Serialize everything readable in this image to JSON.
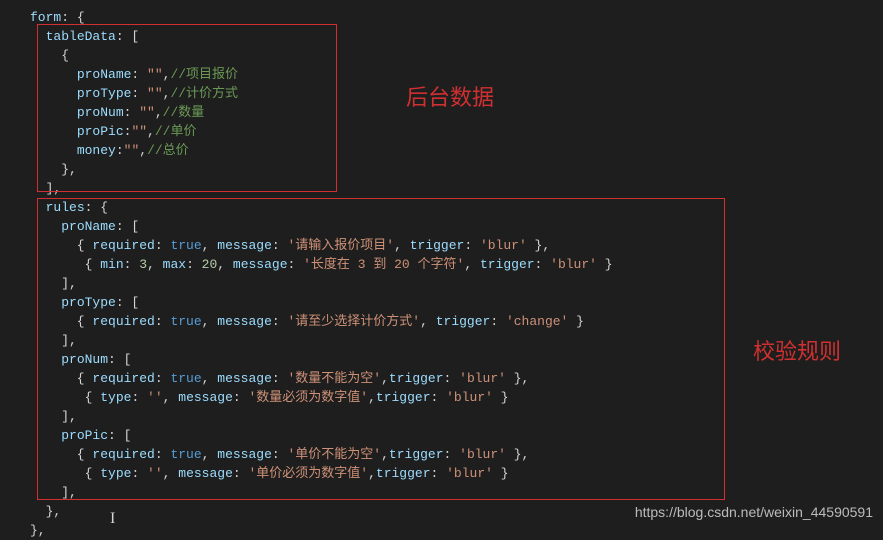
{
  "annotations": {
    "label1": "后台数据",
    "label2": "校验规则",
    "watermark": "https://blog.csdn.net/weixin_44590591"
  },
  "code_tokens": [
    [
      [
        "prop",
        "form"
      ],
      [
        "punct",
        ": {"
      ]
    ],
    [
      [
        "punct",
        "  "
      ],
      [
        "key",
        "tableData"
      ],
      [
        "punct",
        ": ["
      ]
    ],
    [
      [
        "punct",
        "    {"
      ]
    ],
    [
      [
        "punct",
        "      "
      ],
      [
        "key",
        "proName"
      ],
      [
        "punct",
        ": "
      ],
      [
        "str",
        "\"\""
      ],
      [
        "punct",
        ","
      ],
      [
        "comment",
        "//项目报价"
      ]
    ],
    [
      [
        "punct",
        "      "
      ],
      [
        "key",
        "proType"
      ],
      [
        "punct",
        ": "
      ],
      [
        "str",
        "\"\""
      ],
      [
        "punct",
        ","
      ],
      [
        "comment",
        "//计价方式"
      ]
    ],
    [
      [
        "punct",
        "      "
      ],
      [
        "key",
        "proNum"
      ],
      [
        "punct",
        ": "
      ],
      [
        "str",
        "\"\""
      ],
      [
        "punct",
        ","
      ],
      [
        "comment",
        "//数量"
      ]
    ],
    [
      [
        "punct",
        "      "
      ],
      [
        "key",
        "proPic"
      ],
      [
        "punct",
        ":"
      ],
      [
        "str",
        "\"\""
      ],
      [
        "punct",
        ","
      ],
      [
        "comment",
        "//单价"
      ]
    ],
    [
      [
        "punct",
        "      "
      ],
      [
        "key",
        "money"
      ],
      [
        "punct",
        ":"
      ],
      [
        "str",
        "\"\""
      ],
      [
        "punct",
        ","
      ],
      [
        "comment",
        "//总价"
      ]
    ],
    [
      [
        "punct",
        "    },"
      ]
    ],
    [
      [
        "punct",
        "  ],"
      ]
    ],
    [
      [
        "punct",
        "  "
      ],
      [
        "key",
        "rules"
      ],
      [
        "punct",
        ": {"
      ]
    ],
    [
      [
        "punct",
        "    "
      ],
      [
        "key",
        "proName"
      ],
      [
        "punct",
        ": ["
      ]
    ],
    [
      [
        "punct",
        "      { "
      ],
      [
        "key",
        "required"
      ],
      [
        "punct",
        ": "
      ],
      [
        "bool",
        "true"
      ],
      [
        "punct",
        ", "
      ],
      [
        "key",
        "message"
      ],
      [
        "punct",
        ": "
      ],
      [
        "str",
        "'请输入报价项目'"
      ],
      [
        "punct",
        ", "
      ],
      [
        "key",
        "trigger"
      ],
      [
        "punct",
        ": "
      ],
      [
        "str",
        "'blur'"
      ],
      [
        "punct",
        " },"
      ]
    ],
    [
      [
        "punct",
        "       { "
      ],
      [
        "key",
        "min"
      ],
      [
        "punct",
        ": "
      ],
      [
        "num",
        "3"
      ],
      [
        "punct",
        ", "
      ],
      [
        "key",
        "max"
      ],
      [
        "punct",
        ": "
      ],
      [
        "num",
        "20"
      ],
      [
        "punct",
        ", "
      ],
      [
        "key",
        "message"
      ],
      [
        "punct",
        ": "
      ],
      [
        "str",
        "'长度在 3 到 20 个字符'"
      ],
      [
        "punct",
        ", "
      ],
      [
        "key",
        "trigger"
      ],
      [
        "punct",
        ": "
      ],
      [
        "str",
        "'blur'"
      ],
      [
        "punct",
        " }"
      ]
    ],
    [
      [
        "punct",
        "    ],"
      ]
    ],
    [
      [
        "punct",
        "    "
      ],
      [
        "key",
        "proType"
      ],
      [
        "punct",
        ": ["
      ]
    ],
    [
      [
        "punct",
        "      { "
      ],
      [
        "key",
        "required"
      ],
      [
        "punct",
        ": "
      ],
      [
        "bool",
        "true"
      ],
      [
        "punct",
        ", "
      ],
      [
        "key",
        "message"
      ],
      [
        "punct",
        ": "
      ],
      [
        "str",
        "'请至少选择计价方式'"
      ],
      [
        "punct",
        ", "
      ],
      [
        "key",
        "trigger"
      ],
      [
        "punct",
        ": "
      ],
      [
        "str",
        "'change'"
      ],
      [
        "punct",
        " }"
      ]
    ],
    [
      [
        "punct",
        "    ],"
      ]
    ],
    [
      [
        "punct",
        "    "
      ],
      [
        "key",
        "proNum"
      ],
      [
        "punct",
        ": ["
      ]
    ],
    [
      [
        "punct",
        "      { "
      ],
      [
        "key",
        "required"
      ],
      [
        "punct",
        ": "
      ],
      [
        "bool",
        "true"
      ],
      [
        "punct",
        ", "
      ],
      [
        "key",
        "message"
      ],
      [
        "punct",
        ": "
      ],
      [
        "str",
        "'数量不能为空'"
      ],
      [
        "punct",
        ","
      ],
      [
        "key",
        "trigger"
      ],
      [
        "punct",
        ": "
      ],
      [
        "str",
        "'blur'"
      ],
      [
        "punct",
        " },"
      ]
    ],
    [
      [
        "punct",
        "       { "
      ],
      [
        "key",
        "type"
      ],
      [
        "punct",
        ": "
      ],
      [
        "str",
        "''"
      ],
      [
        "punct",
        ", "
      ],
      [
        "key",
        "message"
      ],
      [
        "punct",
        ": "
      ],
      [
        "str",
        "'数量必须为数字值'"
      ],
      [
        "punct",
        ","
      ],
      [
        "key",
        "trigger"
      ],
      [
        "punct",
        ": "
      ],
      [
        "str",
        "'blur'"
      ],
      [
        "punct",
        " }"
      ]
    ],
    [
      [
        "punct",
        "    ],"
      ]
    ],
    [
      [
        "punct",
        "    "
      ],
      [
        "key",
        "proPic"
      ],
      [
        "punct",
        ": ["
      ]
    ],
    [
      [
        "punct",
        "      { "
      ],
      [
        "key",
        "required"
      ],
      [
        "punct",
        ": "
      ],
      [
        "bool",
        "true"
      ],
      [
        "punct",
        ", "
      ],
      [
        "key",
        "message"
      ],
      [
        "punct",
        ": "
      ],
      [
        "str",
        "'单价不能为空'"
      ],
      [
        "punct",
        ","
      ],
      [
        "key",
        "trigger"
      ],
      [
        "punct",
        ": "
      ],
      [
        "str",
        "'blur'"
      ],
      [
        "punct",
        " },"
      ]
    ],
    [
      [
        "punct",
        "       { "
      ],
      [
        "key",
        "type"
      ],
      [
        "punct",
        ": "
      ],
      [
        "str",
        "''"
      ],
      [
        "punct",
        ", "
      ],
      [
        "key",
        "message"
      ],
      [
        "punct",
        ": "
      ],
      [
        "str",
        "'单价必须为数字值'"
      ],
      [
        "punct",
        ","
      ],
      [
        "key",
        "trigger"
      ],
      [
        "punct",
        ": "
      ],
      [
        "str",
        "'blur'"
      ],
      [
        "punct",
        " }"
      ]
    ],
    [
      [
        "punct",
        "    ],"
      ]
    ],
    [
      [
        "punct",
        "  },"
      ]
    ],
    [
      [
        "punct",
        "},"
      ]
    ]
  ]
}
